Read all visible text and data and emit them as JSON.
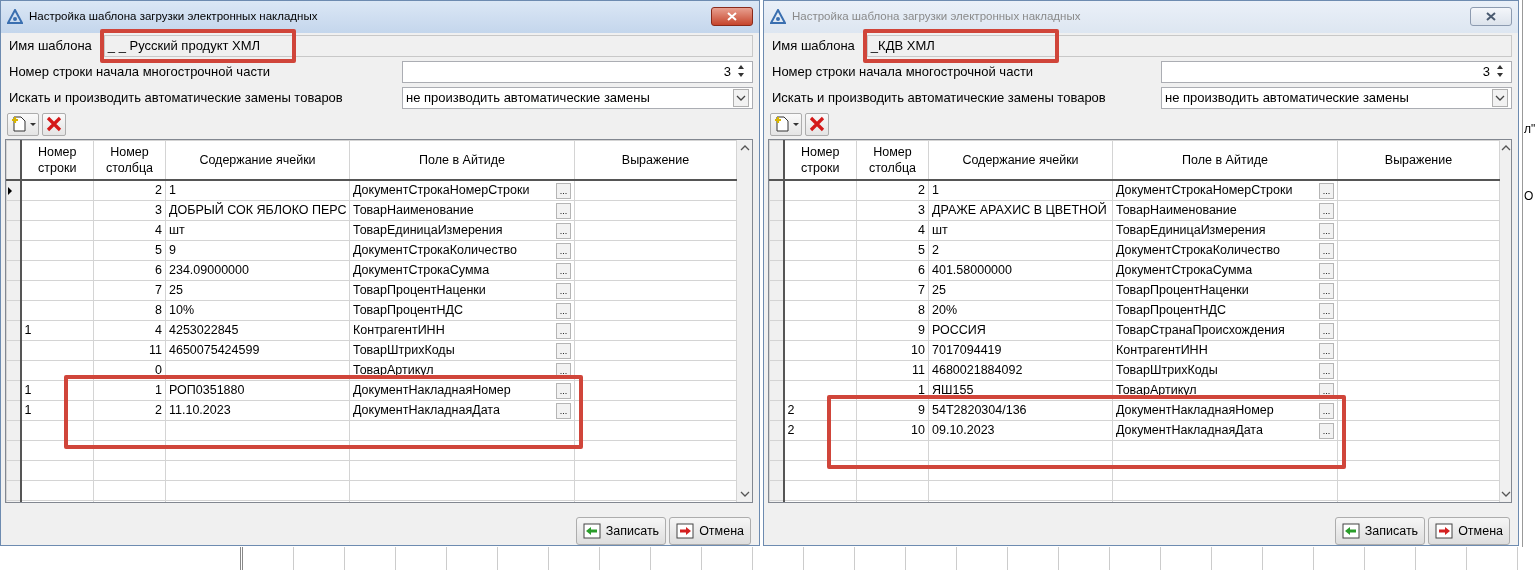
{
  "background_window": {
    "texts": [
      "л\"",
      "О"
    ]
  },
  "dialogs": [
    {
      "title": "Настройка шаблона загрузки электронных накладных",
      "active": true,
      "name_label": "Имя шаблона",
      "name_value": "_ _ Русский продукт ХМЛ",
      "name_highlighted": true,
      "start_row_label": "Номер строки начала многострочной части",
      "start_row_value": "3",
      "replace_label": "Искать и производить автоматические замены товаров",
      "replace_value": "не производить автоматические замены",
      "columns": [
        "Номер строки",
        "Номер столбца",
        "Содержание ячейки",
        "Поле в Айтиде",
        "Выражение"
      ],
      "rows": [
        {
          "row": "",
          "col": "2",
          "content": "1",
          "field": "ДокументСтрокаНомерСтроки",
          "button": "...",
          "current": true,
          "highlighted": false
        },
        {
          "row": "",
          "col": "3",
          "content": "ДОБРЫЙ СОК ЯБЛОКО ПЕРС",
          "field": "ТоварНаименование",
          "button": "...",
          "current": false,
          "highlighted": false
        },
        {
          "row": "",
          "col": "4",
          "content": "шт",
          "field": "ТоварЕдиницаИзмерения",
          "button": "...",
          "current": false,
          "highlighted": false
        },
        {
          "row": "",
          "col": "5",
          "content": "9",
          "field": "ДокументСтрокаКоличество",
          "button": "...",
          "current": false,
          "highlighted": false
        },
        {
          "row": "",
          "col": "6",
          "content": "234.09000000",
          "field": "ДокументСтрокаСумма",
          "button": "...",
          "current": false,
          "highlighted": false
        },
        {
          "row": "",
          "col": "7",
          "content": "25",
          "field": "ТоварПроцентНаценки",
          "button": "...",
          "current": false,
          "highlighted": false
        },
        {
          "row": "",
          "col": "8",
          "content": "10%",
          "field": "ТоварПроцентНДС",
          "button": "...",
          "current": false,
          "highlighted": false
        },
        {
          "row": "1",
          "col": "4",
          "content": "4253022845",
          "field": "КонтрагентИНН",
          "button": "...",
          "current": false,
          "highlighted": false
        },
        {
          "row": "",
          "col": "11",
          "content": "4650075424599",
          "field": "ТоварШтрихКоды",
          "button": "...",
          "current": false,
          "highlighted": false
        },
        {
          "row": "",
          "col": "0",
          "content": "",
          "field": "ТоварАртикул",
          "button": "...",
          "current": false,
          "highlighted": false
        },
        {
          "row": "1",
          "col": "1",
          "content": "РОП0351880",
          "field": "ДокументНакладнаяНомер",
          "button": "...",
          "current": false,
          "highlighted": true
        },
        {
          "row": "1",
          "col": "2",
          "content": "11.10.2023",
          "field": "ДокументНакладнаяДата",
          "button": "...",
          "current": false,
          "highlighted": true
        }
      ],
      "buttons": [
        {
          "kind": "save",
          "label": "Записать"
        },
        {
          "kind": "cancel",
          "label": "Отмена"
        }
      ]
    },
    {
      "title": "Настройка шаблона загрузки электронных накладных",
      "active": false,
      "name_label": "Имя шаблона",
      "name_value": "_КДВ ХМЛ",
      "name_highlighted": true,
      "start_row_label": "Номер строки начала многострочной части",
      "start_row_value": "3",
      "replace_label": "Искать и производить автоматические замены товаров",
      "replace_value": "не производить автоматические замены",
      "columns": [
        "Номер строки",
        "Номер столбца",
        "Содержание ячейки",
        "Поле в Айтиде",
        "Выражение"
      ],
      "rows": [
        {
          "row": "",
          "col": "2",
          "content": "1",
          "field": "ДокументСтрокаНомерСтроки",
          "button": "...",
          "current": false,
          "highlighted": false
        },
        {
          "row": "",
          "col": "3",
          "content": "ДРАЖЕ АРАХИС В ЦВЕТНОЙ",
          "field": "ТоварНаименование",
          "button": "...",
          "current": false,
          "highlighted": false
        },
        {
          "row": "",
          "col": "4",
          "content": "шт",
          "field": "ТоварЕдиницаИзмерения",
          "button": "...",
          "current": false,
          "highlighted": false
        },
        {
          "row": "",
          "col": "5",
          "content": "2",
          "field": "ДокументСтрокаКоличество",
          "button": "...",
          "current": false,
          "highlighted": false
        },
        {
          "row": "",
          "col": "6",
          "content": "401.58000000",
          "field": "ДокументСтрокаСумма",
          "button": "...",
          "current": false,
          "highlighted": false
        },
        {
          "row": "",
          "col": "7",
          "content": "25",
          "field": "ТоварПроцентНаценки",
          "button": "...",
          "current": false,
          "highlighted": false
        },
        {
          "row": "",
          "col": "8",
          "content": "20%",
          "field": "ТоварПроцентНДС",
          "button": "...",
          "current": false,
          "highlighted": false
        },
        {
          "row": "",
          "col": "9",
          "content": "РОССИЯ",
          "field": "ТоварСтранаПроисхождения",
          "button": "...",
          "current": false,
          "highlighted": false
        },
        {
          "row": "",
          "col": "10",
          "content": "7017094419",
          "field": "КонтрагентИНН",
          "button": "...",
          "current": false,
          "highlighted": false
        },
        {
          "row": "",
          "col": "11",
          "content": "4680021884092",
          "field": "ТоварШтрихКоды",
          "button": "...",
          "current": false,
          "highlighted": false
        },
        {
          "row": "",
          "col": "1",
          "content": "ЯШ155",
          "field": "ТоварАртикул",
          "button": "...",
          "current": false,
          "highlighted": false
        },
        {
          "row": "2",
          "col": "9",
          "content": "54Т2820304/136",
          "field": "ДокументНакладнаяНомер",
          "button": "...",
          "current": false,
          "highlighted": true
        },
        {
          "row": "2",
          "col": "10",
          "content": "09.10.2023",
          "field": "ДокументНакладнаяДата",
          "button": "...",
          "current": false,
          "highlighted": true
        }
      ],
      "buttons": [
        {
          "kind": "save",
          "label": "Записать"
        },
        {
          "kind": "cancel",
          "label": "Отмена"
        }
      ]
    }
  ]
}
